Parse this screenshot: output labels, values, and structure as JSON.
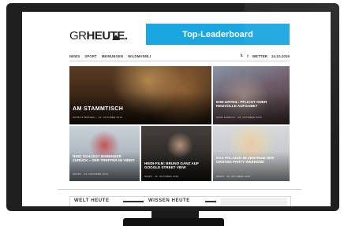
{
  "site": {
    "logo_prefix": "GR",
    "logo_bold": "HEUTE.",
    "leaderboard_label": "Top-Leaderboard"
  },
  "nav": {
    "items": [
      "NEWS",
      "SPORT",
      "MEINUNGEN",
      "WILDMANNLI"
    ],
    "weather": "WETTER",
    "date": "24.10.2019"
  },
  "tiles": [
    {
      "caption": "AM STAMMTISCH",
      "meta": "PATRICK BRÄNDLI · 24. OKTOBER 2019"
    },
    {
      "caption": "EHE-URTEIL: PFLICHT ODER REIZVOLLE AUFGABE?",
      "meta": "ANNA MURPHY · 24. OKTOBER 2019"
    },
    {
      "caption": "NINO SCHLEGT BINNINGER ZURÜCK – DER TREFFER IM VIDEO",
      "meta": "SPORT · 23. OKTOBER 2019"
    },
    {
      "caption": "HEIDI-FILM: BRUNO GANZ AUF GOOGLE STREET VIEW",
      "meta": "NEWS · 23. OKTOBER 2019"
    },
    {
      "caption": "DAS PALAZZO IM ZENTRUM DER GROSSE PARTY WEEKEND",
      "meta": "NEWS · 22. OKTOBER 2019"
    }
  ],
  "sections": {
    "left": "WELT HEUTE",
    "right": "WISSEN HEUTE"
  }
}
